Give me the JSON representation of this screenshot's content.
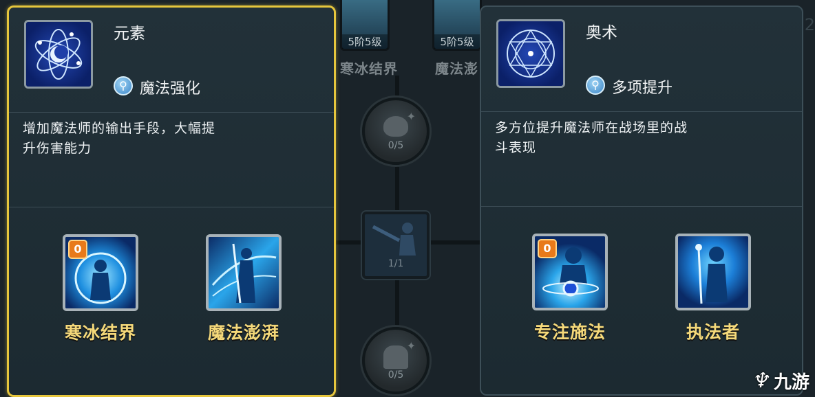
{
  "background": {
    "top_skills": [
      {
        "level": "5阶5级",
        "name": "寒冰结界"
      },
      {
        "level": "5阶5级",
        "name": "魔法澎"
      }
    ],
    "nodes": [
      {
        "count": "0/5",
        "icon": "hat-icon"
      },
      {
        "count": "1/1",
        "icon": "caster-icon"
      },
      {
        "count": "0/5",
        "icon": "robe-icon"
      }
    ],
    "corner_number": "2"
  },
  "panels": [
    {
      "title": "元素",
      "type_label": "魔法强化",
      "description_lines": [
        "增加魔法师的输出手段，大幅提",
        "升伤害能力"
      ],
      "skills": [
        {
          "name": "寒冰结界",
          "badge": "0"
        },
        {
          "name": "魔法澎湃",
          "badge": ""
        }
      ]
    },
    {
      "title": "奥术",
      "type_label": "多项提升",
      "description_lines": [
        "多方位提升魔法师在战场里的战",
        "斗表现"
      ],
      "skills": [
        {
          "name": "专注施法",
          "badge": "0"
        },
        {
          "name": "执法者",
          "badge": ""
        }
      ]
    }
  ],
  "watermark": {
    "text": "九游"
  },
  "colors": {
    "selected_border": "#e6c63d",
    "skill_name": "#f5d97a",
    "panel_bg": "#1f2e35",
    "badge": "#e87a1a"
  }
}
